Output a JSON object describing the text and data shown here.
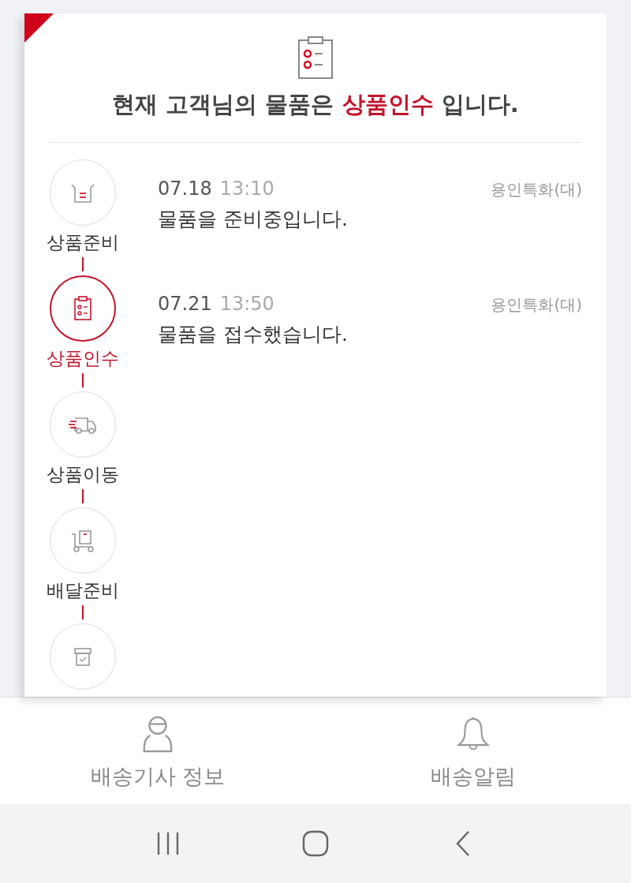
{
  "header": {
    "headline": "현재 고객님의 물품은 **상품인수** 입니다."
  },
  "steps": [
    {
      "kind": "basket",
      "label": "상품준비",
      "selected": false
    },
    {
      "kind": "clipboard",
      "label": "상품인수",
      "selected": true
    },
    {
      "kind": "truck",
      "label": "상품이동",
      "selected": false
    },
    {
      "kind": "cart",
      "label": "배달준비",
      "selected": false
    },
    {
      "kind": "box",
      "selected": false
    }
  ],
  "events": [
    {
      "date": "07.18",
      "time": "13:10",
      "location": "용인특화(대)",
      "message": "물품을 준비중입니다."
    },
    {
      "date": "07.21",
      "time": "13:50",
      "location": "용인특화(대)",
      "message": "물품을 접수했습니다."
    }
  ],
  "bottom_nav": [
    {
      "kind": "driver",
      "label": "배송기사 정보"
    },
    {
      "kind": "bell",
      "label": "배송알림"
    }
  ]
}
